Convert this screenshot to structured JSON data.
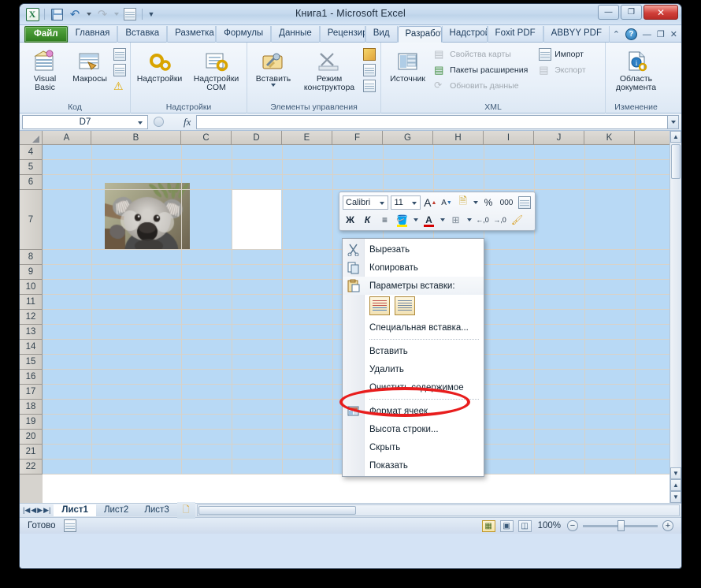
{
  "window": {
    "title": "Книга1  -  Microsoft Excel",
    "minimize": "—",
    "restore": "❐",
    "close": "✕"
  },
  "quick_access": {
    "excel_logo": "X",
    "save_icon": "save-icon",
    "undo_icon": "undo-icon",
    "redo_icon": "redo-icon",
    "print_preview_icon": "print-preview-icon",
    "customize_icon": "customize-qat-icon"
  },
  "tabs": [
    {
      "label": "Файл",
      "type": "file"
    },
    {
      "label": "Главная",
      "type": "normal"
    },
    {
      "label": "Вставка",
      "type": "normal"
    },
    {
      "label": "Разметка с",
      "type": "normal"
    },
    {
      "label": "Формулы",
      "type": "normal"
    },
    {
      "label": "Данные",
      "type": "normal"
    },
    {
      "label": "Рецензир",
      "type": "normal"
    },
    {
      "label": "Вид",
      "type": "normal"
    },
    {
      "label": "Разработч",
      "type": "active"
    },
    {
      "label": "Надстройи",
      "type": "normal"
    },
    {
      "label": "Foxit PDF",
      "type": "normal"
    },
    {
      "label": "ABBYY PDF",
      "type": "normal"
    }
  ],
  "tabs_right": {
    "minimize_ribbon_icon": "minimize-ribbon-icon",
    "help_icon": "?",
    "win_minimize": "—",
    "win_restore": "❐",
    "win_close": "✕"
  },
  "ribbon": {
    "groups": [
      {
        "name": "Код",
        "label": "Код",
        "big_buttons": [
          {
            "label": "Visual\nBasic",
            "line1": "Visual",
            "line2": "Basic",
            "icon": "visual-basic-icon"
          },
          {
            "label": "Макросы",
            "line1": "Макросы",
            "line2": "",
            "icon": "macros-icon"
          }
        ],
        "small_buttons": [
          {
            "label": "",
            "icon": "record-macro-icon"
          },
          {
            "label": "",
            "icon": "relative-reference-icon"
          },
          {
            "label": "",
            "icon": "macro-security-icon"
          }
        ]
      },
      {
        "name": "Надстройки",
        "label": "Надстройки",
        "big_buttons": [
          {
            "line1": "Надстройки",
            "line2": "",
            "icon": "addins-icon"
          },
          {
            "line1": "Надстройки",
            "line2": "COM",
            "icon": "com-addins-icon"
          }
        ],
        "small_buttons": []
      },
      {
        "name": "Элементы управления",
        "label": "Элементы управления",
        "big_buttons": [
          {
            "line1": "Вставить",
            "line2": "",
            "icon": "insert-control-icon",
            "has_dropdown": true
          },
          {
            "line1": "Режим",
            "line2": "конструктора",
            "icon": "design-mode-icon"
          }
        ],
        "small_buttons": [
          {
            "label": "",
            "icon": "properties-icon"
          },
          {
            "label": "",
            "icon": "view-code-icon"
          },
          {
            "label": "",
            "icon": "run-dialog-icon"
          }
        ]
      },
      {
        "name": "XML",
        "label": "XML",
        "big_buttons": [
          {
            "line1": "Источник",
            "line2": "",
            "icon": "xml-source-icon"
          }
        ],
        "small_buttons": [
          {
            "label": "Свойства карты",
            "icon": "map-properties-icon",
            "disabled": true
          },
          {
            "label": "Пакеты расширения",
            "icon": "expansion-packs-icon",
            "disabled": false
          },
          {
            "label": "Обновить данные",
            "icon": "refresh-data-icon",
            "disabled": true
          },
          {
            "label": "Импорт",
            "icon": "import-icon",
            "disabled": false
          },
          {
            "label": "Экспорт",
            "icon": "export-icon",
            "disabled": true
          }
        ]
      },
      {
        "name": "Изменение",
        "label": "Изменение",
        "big_buttons": [
          {
            "line1": "Область",
            "line2": "документа",
            "icon": "document-panel-icon"
          }
        ],
        "small_buttons": []
      }
    ]
  },
  "formula_bar": {
    "name_box_value": "D7",
    "fx_label": "fx",
    "input_value": "",
    "expand_icon": "chevron-down-icon"
  },
  "grid": {
    "columns": [
      "A",
      "B",
      "C",
      "D",
      "E",
      "F",
      "G",
      "H",
      "I",
      "J",
      "K"
    ],
    "rows": [
      "4",
      "5",
      "6",
      "7",
      "8",
      "9",
      "10",
      "11",
      "12",
      "13",
      "14",
      "15",
      "16",
      "17",
      "18",
      "19",
      "20",
      "21",
      "22"
    ],
    "active_cell": "D7",
    "tall_row": "7",
    "picture_name": "koala-image",
    "selection_fill": "#b8d9f5"
  },
  "mini_toolbar": {
    "font_name": "Calibri",
    "font_size": "11",
    "grow_font": "A",
    "shrink_font": "A",
    "accounting_format": "money-format-icon",
    "percent": "%",
    "comma_style": "000",
    "format_cells_icon": "format-cells-icon",
    "bold": "Ж",
    "italic": "К",
    "align": "align-icon",
    "fill_color": "fill-color-icon",
    "font_color": "A",
    "borders": "borders-icon",
    "increase_decimal": "increase-decimal-icon",
    "decrease_decimal": "decrease-decimal-icon",
    "format_painter": "format-painter-icon"
  },
  "context_menu": {
    "items": [
      {
        "label": "Вырезать",
        "icon": "cut-icon",
        "type": "item"
      },
      {
        "label": "Копировать",
        "icon": "copy-icon",
        "type": "item"
      },
      {
        "label": "Параметры вставки:",
        "icon": "paste-icon",
        "type": "header"
      },
      {
        "label": "paste-options",
        "type": "paste-options"
      },
      {
        "label": "Специальная вставка...",
        "icon": "",
        "type": "item"
      },
      {
        "label": "separator",
        "type": "separator"
      },
      {
        "label": "Вставить",
        "icon": "",
        "type": "item"
      },
      {
        "label": "Удалить",
        "icon": "",
        "type": "item"
      },
      {
        "label": "Очистить содержимое",
        "icon": "",
        "type": "item"
      },
      {
        "label": "separator",
        "type": "separator"
      },
      {
        "label": "Формат ячеек...",
        "icon": "format-cells-icon",
        "type": "item",
        "highlighted": true
      },
      {
        "label": "Высота строки...",
        "icon": "",
        "type": "item"
      },
      {
        "label": "Скрыть",
        "icon": "",
        "type": "item"
      },
      {
        "label": "Показать",
        "icon": "",
        "type": "item"
      }
    ]
  },
  "sheet_tabs": {
    "nav_first": "|◀",
    "nav_prev": "◀",
    "nav_next": "▶",
    "nav_last": "▶|",
    "tabs": [
      "Лист1",
      "Лист2",
      "Лист3"
    ],
    "active": "Лист1",
    "insert_sheet_icon": "insert-sheet-icon"
  },
  "status_bar": {
    "status_text": "Готово",
    "macro_record_icon": "record-macro-icon",
    "view_normal_icon": "view-normal-icon",
    "view_layout_icon": "view-page-layout-icon",
    "view_break_icon": "view-page-break-icon",
    "zoom_level": "100%",
    "zoom_out": "−",
    "zoom_in": "+"
  },
  "colors": {
    "accent_green": "#2e7d1e",
    "highlight_red": "#e81d1d",
    "selection_blue": "#b8d9f5",
    "titlebar_blue": "#c6d9ee"
  }
}
